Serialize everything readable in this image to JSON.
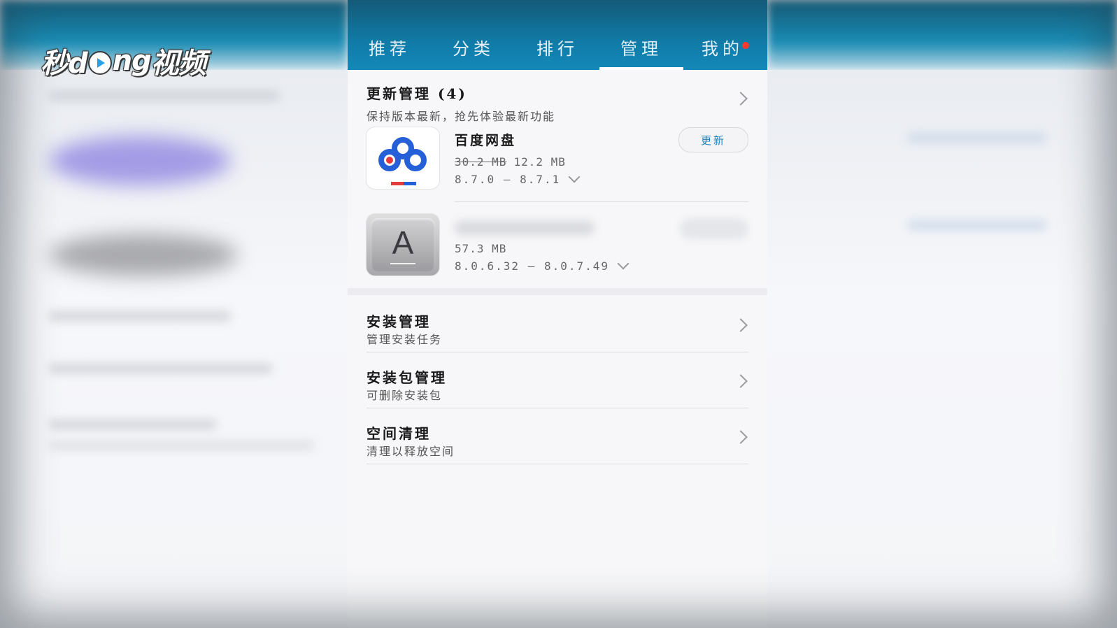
{
  "watermark": {
    "text_left": "秒d",
    "text_mid": "ng",
    "text_right": "视频"
  },
  "tabs": [
    {
      "label": "推荐",
      "active": false
    },
    {
      "label": "分类",
      "active": false
    },
    {
      "label": "排行",
      "active": false
    },
    {
      "label": "管理",
      "active": true
    },
    {
      "label": "我的",
      "active": false,
      "badge": true
    }
  ],
  "update_section": {
    "title": "更新管理 (4)",
    "subtitle": "保持版本最新，抢先体验最新功能"
  },
  "apps": [
    {
      "name": "百度网盘",
      "size_old": "30.2 MB",
      "size_new": "12.2 MB",
      "version": "8.7.0 — 8.7.1",
      "button": "更新",
      "icon": "baidu-netdisk-icon"
    },
    {
      "name": "",
      "size_new": "57.3 MB",
      "version": "8.0.6.32 — 8.0.7.49",
      "icon": "app-a-icon",
      "icon_letter": "A"
    }
  ],
  "menu": [
    {
      "title": "安装管理",
      "subtitle": "管理安装任务"
    },
    {
      "title": "安装包管理",
      "subtitle": "可删除安装包"
    },
    {
      "title": "空间清理",
      "subtitle": "清理以释放空间"
    }
  ],
  "colors": {
    "header": "#1488b8",
    "update_button_text": "#1a7fbf",
    "badge": "#ff3b30"
  }
}
